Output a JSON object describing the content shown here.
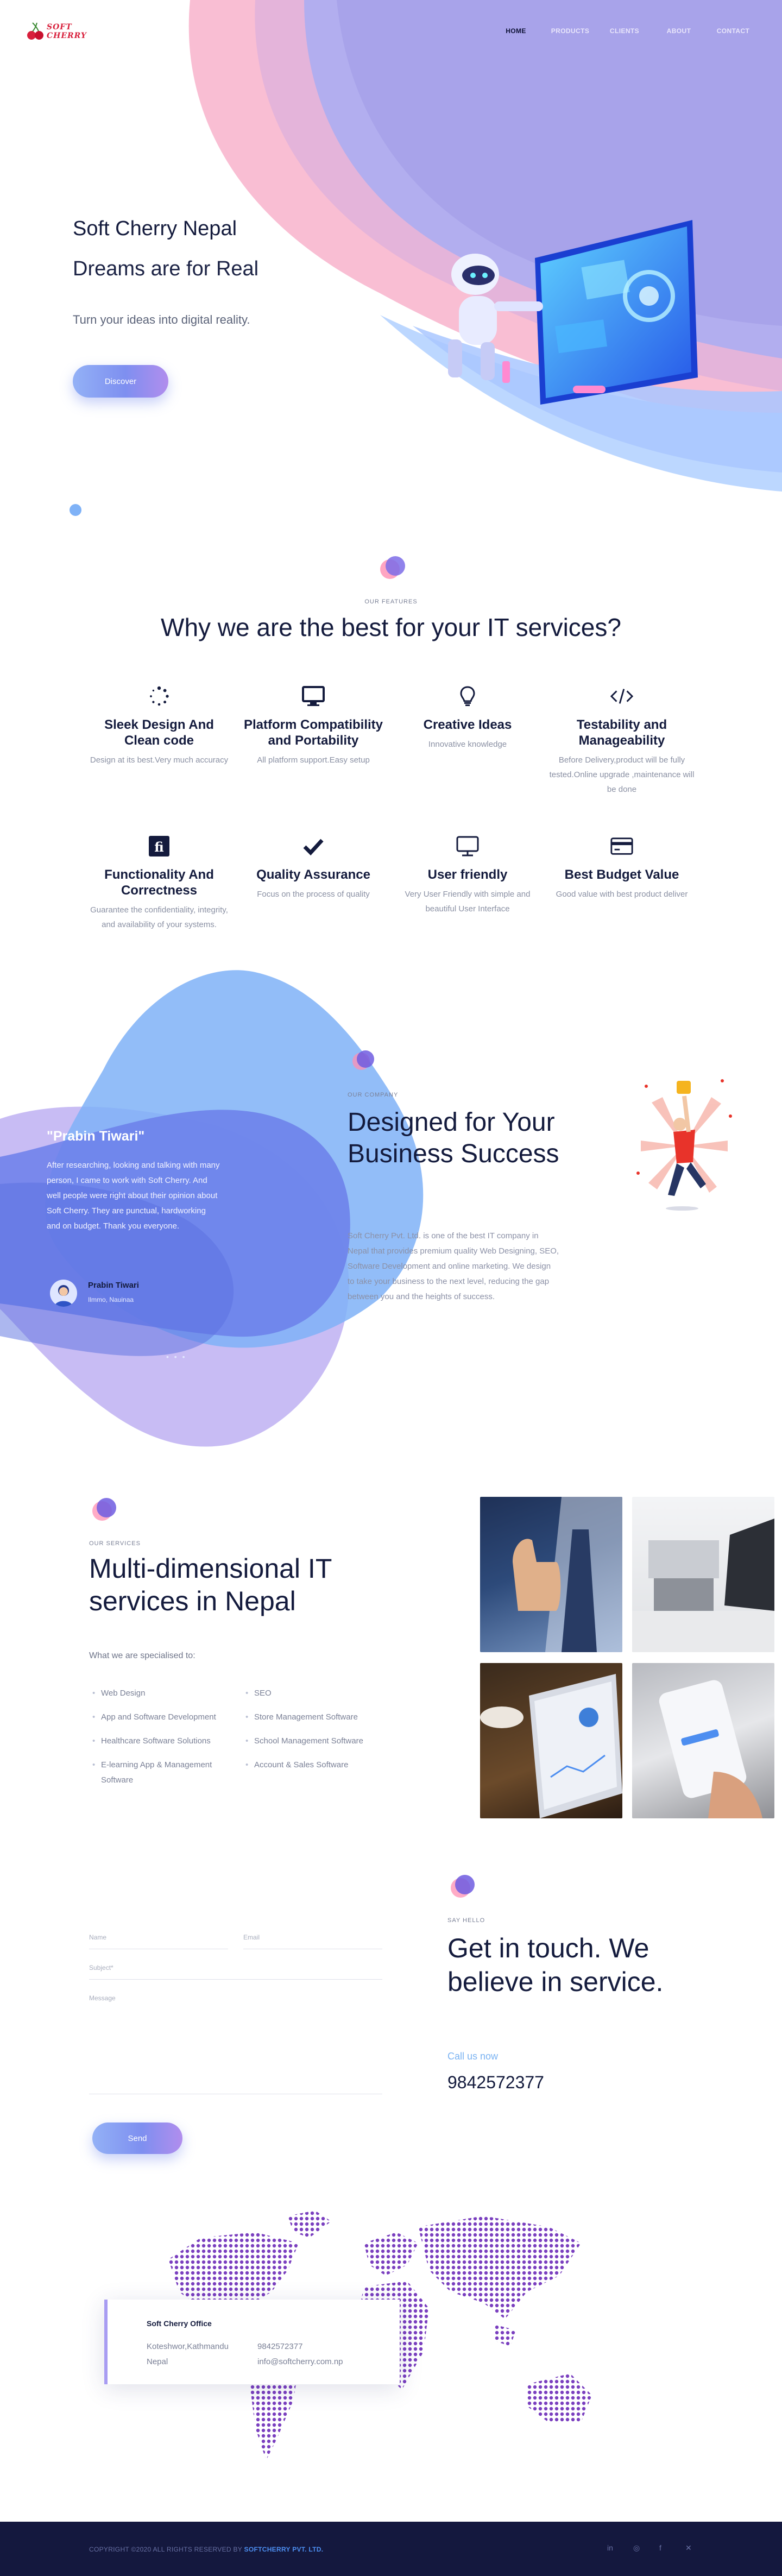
{
  "colors": {
    "accent_blue": "#4d8ef0",
    "lavender": "#b0a8ed",
    "pink": "#f8b6cd",
    "navy": "#141b3d",
    "footer_bg": "#14183e"
  },
  "header": {
    "logo_line1": "SOFT",
    "logo_line2": "CHERRY",
    "nav": [
      "HOME",
      "PRODUCTS",
      "CLIENTS",
      "ABOUT",
      "CONTACT"
    ],
    "active_nav": "HOME"
  },
  "hero": {
    "title": "Soft Cherry Nepal",
    "subtitle": "Dreams are for Real",
    "tagline": "Turn your ideas into digital reality.",
    "button": "Discover"
  },
  "features": {
    "eyebrow": "OUR FEATURES",
    "title": "Why we are the best for your IT services?",
    "items": [
      {
        "icon": "spinner-icon",
        "title": "Sleek Design And Clean code",
        "desc": "Design at its best.Very much accuracy"
      },
      {
        "icon": "monitor-icon",
        "title": "Platform Compatibility and Portability",
        "desc": "All platform support.Easy setup"
      },
      {
        "icon": "lightbulb-icon",
        "title": "Creative Ideas",
        "desc": "Innovative knowledge"
      },
      {
        "icon": "code-icon",
        "title": "Testability and Manageability",
        "desc": "Before Delivery,product will be fully tested.Online upgrade ,maintenance will be done"
      },
      {
        "icon": "fiverr-icon",
        "title": "Functionality And Correctness",
        "desc": "Guarantee the confidentiality, integrity, and availability of your systems."
      },
      {
        "icon": "checkmark-icon",
        "title": "Quality Assurance",
        "desc": "Focus on the process of quality"
      },
      {
        "icon": "desktop-icon",
        "title": "User friendly",
        "desc": "Very User Friendly with simple and beautiful User Interface"
      },
      {
        "icon": "credit-card-icon",
        "title": "Best Budget Value",
        "desc": "Good value with best product deliver"
      }
    ]
  },
  "testimonial": {
    "name": "\"Prabin Tiwari\"",
    "text": "After researching, looking and talking with many person, I came to work with Soft Cherry. And well people were right about their opinion about Soft Cherry. They are punctual, hardworking and on budget. Thank you everyone.",
    "author": "Prabin Tiwari",
    "role": "Ilmmo, Nauinaa",
    "dots": "• • •"
  },
  "company": {
    "eyebrow": "OUR COMPANY",
    "title": "Designed for Your Business Success",
    "desc": "Soft Cherry Pvt. Ltd. is one of the best IT company in Nepal that provides premium quality Web Designing, SEO, Software Development and online marketing. We design to take your business to the next level, reducing the gap between you and the heights of success."
  },
  "services": {
    "eyebrow": "OUR SERVICES",
    "title": "Multi-dimensional IT services in Nepal",
    "intro": "What we are specialised to:",
    "col1": [
      "Web Design",
      "App and Software Development",
      "Healthcare Software Solutions",
      "E-learning App & Management Software"
    ],
    "col2": [
      "SEO",
      "Store Management Software",
      "School Management Software",
      "Account & Sales Software"
    ]
  },
  "contact": {
    "eyebrow": "SAY HELLO",
    "title": "Get in touch. We believe in service.",
    "name_placeholder": "Name",
    "email_placeholder": "Email",
    "subject_placeholder": "Subject*",
    "message_placeholder": "Message",
    "send": "Send",
    "call_label": "Call us now",
    "phone": "9842572377"
  },
  "office": {
    "title": "Soft Cherry Office",
    "address1": "Koteshwor,Kathmandu",
    "address2": "Nepal",
    "phone": "9842572377",
    "email": "info@softcherry.com.np"
  },
  "footer": {
    "copyright": "COPYRIGHT ©2020 ALL RIGHTS RESERVED BY",
    "company": "SOFTCHERRY PVT. LTD.",
    "socials": [
      "in",
      "◎",
      "f",
      "✕"
    ]
  }
}
